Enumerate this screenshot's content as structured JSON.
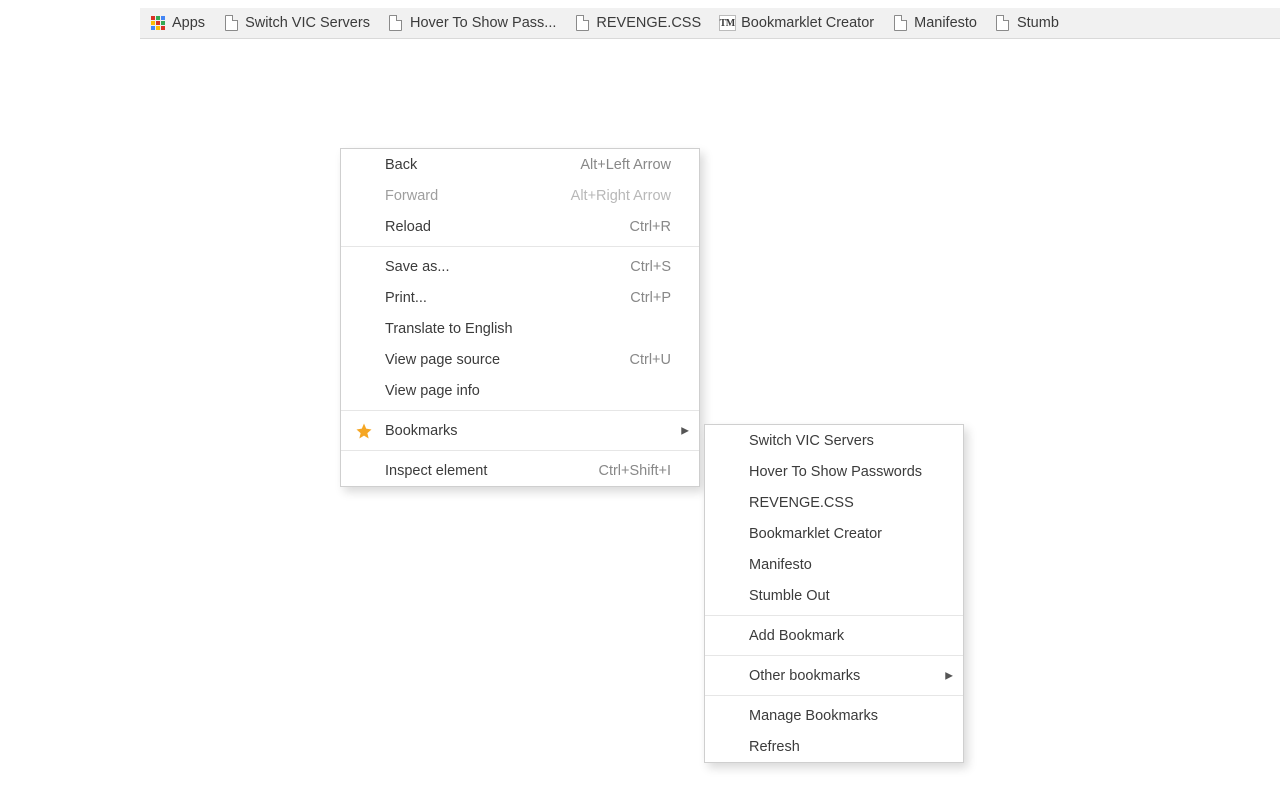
{
  "bookmarksBar": {
    "items": [
      {
        "label": "Apps",
        "iconType": "apps"
      },
      {
        "label": "Switch VIC Servers",
        "iconType": "page"
      },
      {
        "label": "Hover To Show Pass...",
        "iconType": "page"
      },
      {
        "label": "REVENGE.CSS",
        "iconType": "page"
      },
      {
        "label": "Bookmarklet Creator",
        "iconType": "tm"
      },
      {
        "label": "Manifesto",
        "iconType": "page"
      },
      {
        "label": "Stumb",
        "iconType": "page"
      }
    ]
  },
  "contextMenu": {
    "items": [
      {
        "label": "Back",
        "shortcut": "Alt+Left Arrow",
        "disabled": false
      },
      {
        "label": "Forward",
        "shortcut": "Alt+Right Arrow",
        "disabled": true
      },
      {
        "label": "Reload",
        "shortcut": "Ctrl+R"
      },
      "---",
      {
        "label": "Save as...",
        "shortcut": "Ctrl+S"
      },
      {
        "label": "Print...",
        "shortcut": "Ctrl+P"
      },
      {
        "label": "Translate to English"
      },
      {
        "label": "View page source",
        "shortcut": "Ctrl+U"
      },
      {
        "label": "View page info"
      },
      "---",
      {
        "label": "Bookmarks",
        "hasSubmenu": true,
        "leadingIcon": "star"
      },
      "---",
      {
        "label": "Inspect element",
        "shortcut": "Ctrl+Shift+I"
      }
    ]
  },
  "bookmarksSubmenu": {
    "items": [
      {
        "label": "Switch VIC Servers"
      },
      {
        "label": "Hover To Show Passwords"
      },
      {
        "label": "REVENGE.CSS"
      },
      {
        "label": "Bookmarklet Creator"
      },
      {
        "label": "Manifesto"
      },
      {
        "label": "Stumble Out"
      },
      "---",
      {
        "label": "Add Bookmark"
      },
      "---",
      {
        "label": "Other bookmarks",
        "hasSubmenu": true
      },
      "---",
      {
        "label": "Manage Bookmarks"
      },
      {
        "label": "Refresh"
      }
    ]
  },
  "colors": {
    "starFill": "#f5a623"
  }
}
